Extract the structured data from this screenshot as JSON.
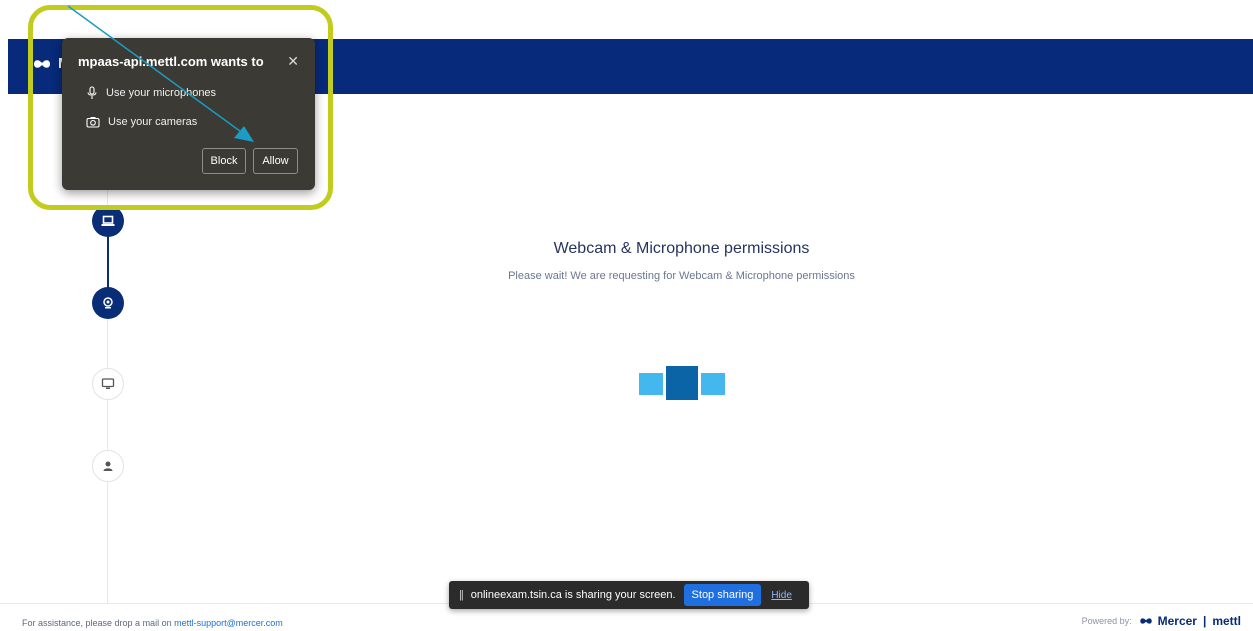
{
  "header": {
    "logo_initial": "M",
    "bar_color": "#072a7a"
  },
  "stepper": {
    "steps": [
      {
        "icon": "laptop-icon",
        "state": "active"
      },
      {
        "icon": "webcam-icon",
        "state": "active"
      },
      {
        "icon": "monitor-icon",
        "state": "inactive"
      },
      {
        "icon": "user-icon",
        "state": "inactive"
      }
    ]
  },
  "main": {
    "title": "Webcam & Microphone permissions",
    "subtitle": "Please wait! We are requesting for Webcam & Microphone permissions"
  },
  "permission_popup": {
    "title": "mpaas-api.mettl.com wants to",
    "close_icon": "close-icon",
    "permissions": [
      {
        "icon": "microphone-icon",
        "label": "Use your microphones"
      },
      {
        "icon": "camera-icon",
        "label": "Use your cameras"
      }
    ],
    "block_label": "Block",
    "allow_label": "Allow",
    "highlight_color": "#c2cc1f"
  },
  "share_bar": {
    "message": "onlineexam.tsin.ca is sharing your screen.",
    "stop_label": "Stop sharing",
    "hide_label": "Hide"
  },
  "footer": {
    "assist_text": "For assistance, please drop a mail on",
    "email": "mettl-support@mercer.com",
    "powered_by": "Powered by:",
    "brand1": "Mercer",
    "separator": "|",
    "brand2": "mettl"
  },
  "colors": {
    "primary": "#0a2d78",
    "loader_light": "#44b8ee",
    "loader_dark": "#0b64a6",
    "annotation_arrow": "#1b9cc4"
  }
}
